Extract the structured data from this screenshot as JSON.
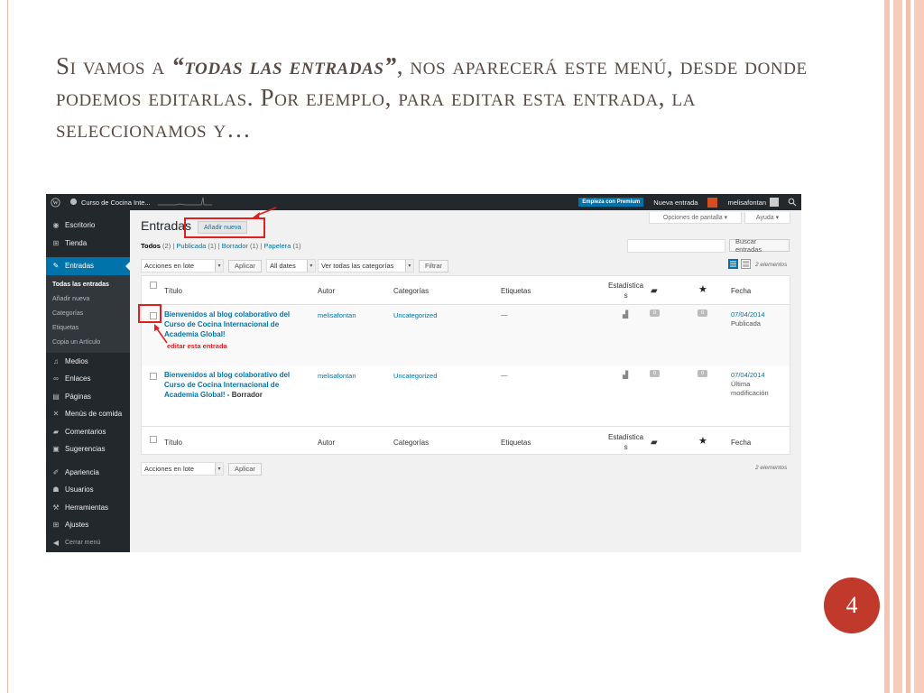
{
  "slide": {
    "title_part1": "Si vamos a ",
    "title_emph": "“todas las entradas”",
    "title_part2": ", nos aparecerá este menú, desde donde podemos editarlas. Por ejemplo, para editar esta entrada, la seleccionamos y…",
    "page_number": "4"
  },
  "adminbar": {
    "wp_logo_icon": "wordpress-icon",
    "site_name": "Curso de Cocina Inte...",
    "premium": "Empieza con Premium",
    "new_entry": "Nueva entrada",
    "user": "melisafontan",
    "search_icon": "search-icon"
  },
  "sidebar": {
    "items": [
      {
        "label": "Escritorio",
        "icon": "dashboard-icon"
      },
      {
        "label": "Tienda",
        "icon": "cart-icon"
      },
      {
        "label": "Entradas",
        "icon": "pin-icon"
      },
      {
        "label": "Medios",
        "icon": "media-icon"
      },
      {
        "label": "Enlaces",
        "icon": "link-icon"
      },
      {
        "label": "Páginas",
        "icon": "page-icon"
      },
      {
        "label": "Menús de comida",
        "icon": "food-icon"
      },
      {
        "label": "Comentarios",
        "icon": "comment-icon"
      },
      {
        "label": "Sugerencias",
        "icon": "feedback-icon"
      },
      {
        "label": "Apariencia",
        "icon": "brush-icon"
      },
      {
        "label": "Usuarios",
        "icon": "users-icon"
      },
      {
        "label": "Herramientas",
        "icon": "wrench-icon"
      },
      {
        "label": "Ajustes",
        "icon": "settings-icon"
      },
      {
        "label": "Cerrar menú",
        "icon": "collapse-icon"
      }
    ],
    "submenu": [
      "Todas las entradas",
      "Añadir nueva",
      "Categorías",
      "Etiquetas",
      "Copia un Artículo"
    ]
  },
  "screen": {
    "page_title": "Entradas",
    "add_new": "Añadir nueva",
    "screen_options": "Opciones de pantalla ▾",
    "help": "Ayuda ▾",
    "filters": {
      "all": "Todos",
      "all_count": "(2)",
      "published": "Publicada",
      "published_count": "(1)",
      "draft": "Borrador",
      "draft_count": "(1)",
      "trash": "Papelera",
      "trash_count": "(1)",
      "sep": "|"
    },
    "search_button": "Buscar entradas",
    "search_value": "",
    "bulk_actions": "Acciones en lote",
    "apply": "Aplicar",
    "all_dates": "All dates",
    "all_categories": "Ver todas las categorías",
    "filter": "Filtrar",
    "item_count": "2 elementos"
  },
  "table": {
    "columns": [
      "Título",
      "Autor",
      "Categorías",
      "Etiquetas",
      "Estadística",
      "s",
      "Fecha"
    ],
    "rows": [
      {
        "title": "Bienvenidos al blog colaborativo del Curso de Cocina Internacional de Academia Global!",
        "state": "",
        "author": "melisafontan",
        "category": "Uncategorized",
        "tags": "—",
        "comments": "0",
        "stars": "0",
        "date": "07/04/2014",
        "status": "Publicada"
      },
      {
        "title": "Bienvenidos al blog colaborativo del Curso de Cocina Internacional de Academia Global!",
        "state": " - Borrador",
        "author": "melisafontan",
        "category": "Uncategorized",
        "tags": "—",
        "comments": "0",
        "stars": "0",
        "date": "07/04/2014",
        "status": "Última modificación"
      }
    ]
  },
  "annotation": {
    "text": "editar esta entrada",
    "color": "#e02020"
  },
  "colors": {
    "admin_bar": "#23282d",
    "accent": "#0073aa",
    "badge": "#c0392b"
  }
}
